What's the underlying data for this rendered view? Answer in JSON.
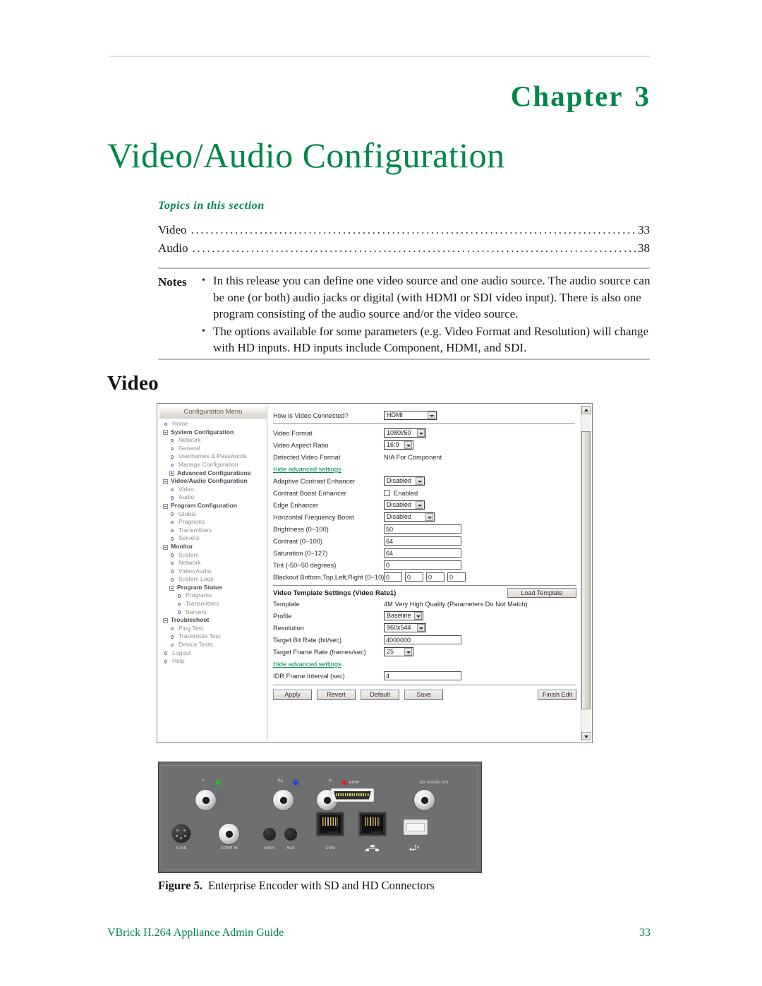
{
  "document": {
    "chapter_label": "Chapter",
    "chapter_number": "3",
    "chapter_title": "Video/Audio Configuration",
    "topics_heading": "Topics in this section",
    "section_heading": "Video",
    "figure_caption_label": "Figure 5.",
    "figure_caption_text": "Enterprise Encoder with SD and HD Connectors",
    "footer_left": "VBrick H.264 Appliance Admin Guide",
    "footer_right": "33",
    "accent_color": "#00874a"
  },
  "toc": [
    {
      "label": "Video",
      "page": "33"
    },
    {
      "label": "Audio",
      "page": "38"
    }
  ],
  "notes": {
    "label": "Notes",
    "items": [
      "In this release you can define one video source and one audio source. The audio source can be one (or both) audio jacks or digital (with HDMI or SDI video input). There is also one program consisting of the audio source and/or the video source.",
      "The options available for some parameters (e.g. Video Format and Resolution) will change with HD inputs. HD inputs include Component, HDMI, and SDI."
    ]
  },
  "screenshot": {
    "sidebar": {
      "title": "Configuration Menu",
      "items": [
        {
          "label": "Home",
          "level": 0,
          "icon": "dot-icon",
          "bold": false
        },
        {
          "label": "System Configuration",
          "level": 0,
          "icon": "minus-box-icon",
          "bold": true
        },
        {
          "label": "Network",
          "level": 1,
          "icon": "dot-icon",
          "bold": false
        },
        {
          "label": "General",
          "level": 1,
          "icon": "dot-icon",
          "bold": false
        },
        {
          "label": "Usernames & Passwords",
          "level": 1,
          "icon": "dot-icon",
          "bold": false
        },
        {
          "label": "Manage Configuration",
          "level": 1,
          "icon": "dot-icon",
          "bold": false
        },
        {
          "label": "Advanced Configurations",
          "level": 1,
          "icon": "plus-box-icon",
          "bold": true
        },
        {
          "label": "Video/Audio Configuration",
          "level": 0,
          "icon": "minus-box-icon",
          "bold": true
        },
        {
          "label": "Video",
          "level": 1,
          "icon": "dot-icon",
          "bold": false
        },
        {
          "label": "Audio",
          "level": 1,
          "icon": "dot-icon",
          "bold": false
        },
        {
          "label": "Program Configuration",
          "level": 0,
          "icon": "minus-box-icon",
          "bold": true
        },
        {
          "label": "Global",
          "level": 1,
          "icon": "dot-icon",
          "bold": false
        },
        {
          "label": "Programs",
          "level": 1,
          "icon": "dot-icon",
          "bold": false
        },
        {
          "label": "Transmitters",
          "level": 1,
          "icon": "dot-icon",
          "bold": false
        },
        {
          "label": "Servers",
          "level": 1,
          "icon": "dot-icon",
          "bold": false
        },
        {
          "label": "Monitor",
          "level": 0,
          "icon": "minus-box-icon",
          "bold": true
        },
        {
          "label": "System",
          "level": 1,
          "icon": "dot-icon",
          "bold": false
        },
        {
          "label": "Network",
          "level": 1,
          "icon": "dot-icon",
          "bold": false
        },
        {
          "label": "Video/Audio",
          "level": 1,
          "icon": "dot-icon",
          "bold": false
        },
        {
          "label": "System Logs",
          "level": 1,
          "icon": "dot-icon",
          "bold": false
        },
        {
          "label": "Program Status",
          "level": 1,
          "icon": "minus-box-icon",
          "bold": true
        },
        {
          "label": "Programs",
          "level": 2,
          "icon": "dot-icon",
          "bold": false
        },
        {
          "label": "Transmitters",
          "level": 2,
          "icon": "dot-icon",
          "bold": false
        },
        {
          "label": "Servers",
          "level": 2,
          "icon": "dot-icon",
          "bold": false
        },
        {
          "label": "Troubleshoot",
          "level": 0,
          "icon": "minus-box-icon",
          "bold": true
        },
        {
          "label": "Ping Test",
          "level": 1,
          "icon": "dot-icon",
          "bold": false
        },
        {
          "label": "Traceroute Test",
          "level": 1,
          "icon": "dot-icon",
          "bold": false
        },
        {
          "label": "Device Tests",
          "level": 1,
          "icon": "dot-icon",
          "bold": false
        },
        {
          "label": "Logout",
          "level": 0,
          "icon": "dot-icon",
          "bold": false
        },
        {
          "label": "Help",
          "level": 0,
          "icon": "dot-icon",
          "bold": false
        }
      ]
    },
    "form": {
      "connection": {
        "label": "How is Video Connected?",
        "value": "HDMI"
      },
      "video_format": {
        "label": "Video Format",
        "value": "1080i/50"
      },
      "aspect_ratio": {
        "label": "Video Aspect Ratio",
        "value": "16:9"
      },
      "detected_format": {
        "label": "Detected Video Format",
        "value": "N/A For Component"
      },
      "hide_advanced_1": "Hide advanced settings",
      "adaptive_contrast": {
        "label": "Adaptive Contrast Enhancer",
        "value": "Disabled"
      },
      "contrast_boost": {
        "label": "Contrast Boost Enhancer",
        "value": "Enabled",
        "checked": false
      },
      "edge_enhancer": {
        "label": "Edge Enhancer",
        "value": "Disabled"
      },
      "horizontal_freq_boost": {
        "label": "Horizontal Frequency Boost",
        "value": "Disabled"
      },
      "brightness": {
        "label": "Brightness (0~100)",
        "value": "50"
      },
      "contrast": {
        "label": "Contrast (0~100)",
        "value": "64"
      },
      "saturation": {
        "label": "Saturation (0~127)",
        "value": "64"
      },
      "tint": {
        "label": "Tint (-50~50 degrees)",
        "value": "0"
      },
      "blackout": {
        "label": "Blackout Bottom,Top,Left,Right (0~10)",
        "values": [
          "0",
          "0",
          "0",
          "0"
        ]
      }
    },
    "template_section": {
      "title": "Video Template Settings (Video Rate1)",
      "load_button": "Load Template",
      "template": {
        "label": "Template",
        "value": "4M Very High Quality (Parameters Do Not Match)"
      },
      "profile": {
        "label": "Profile",
        "value": "Baseline"
      },
      "resolution": {
        "label": "Resolution",
        "value": "960x544"
      },
      "target_bit_rate": {
        "label": "Target Bit Rate (bit/sec)",
        "value": "4000000"
      },
      "target_frame_rate": {
        "label": "Target Frame Rate (frames/sec)",
        "value": "25"
      },
      "hide_advanced_2": "Hide advanced settings",
      "idr_interval": {
        "label": "IDR Frame Interval (sec)",
        "value": "4"
      }
    },
    "buttons": {
      "apply": "Apply",
      "revert": "Revert",
      "default": "Default",
      "save": "Save",
      "finish_edit": "Finish Edit"
    }
  },
  "photo": {
    "labels": {
      "y": "Y",
      "pb": "Pb",
      "pr": "Pr",
      "hdmi": "HDMI",
      "sdi": "SD-SDI/HD-SDI",
      "svid": "S-VID",
      "comp_in": "COMP IN",
      "main": "MAIN",
      "aux": "AUX",
      "com": "COM",
      "usb": "USB"
    },
    "led_colors": {
      "y": "#22c32a",
      "pb": "#1f43e0",
      "pr": "#e01f1f"
    }
  }
}
